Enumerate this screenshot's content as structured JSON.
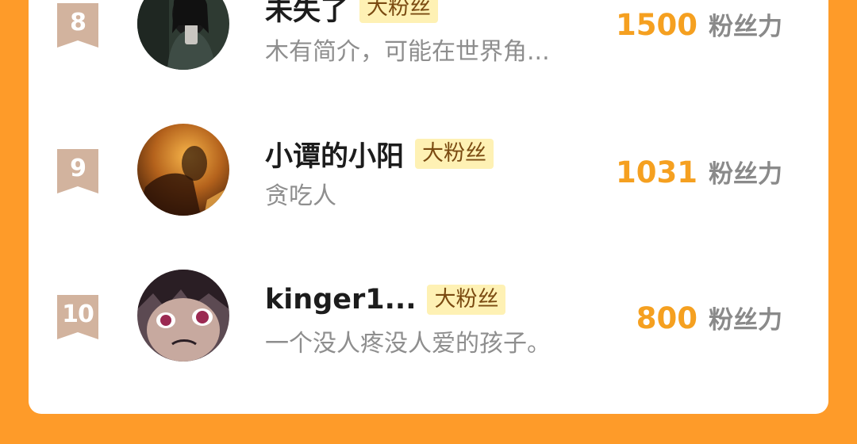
{
  "fans": [
    {
      "rank": "8",
      "name": "未失了",
      "tag": "大粉丝",
      "bio": "木有简介，可能在世界角...",
      "score": "1500",
      "score_unit": "粉丝力"
    },
    {
      "rank": "9",
      "name": "小谭的小阳",
      "tag": "大粉丝",
      "bio": "贪吃人",
      "score": "1031",
      "score_unit": "粉丝力"
    },
    {
      "rank": "10",
      "name": "kinger1...",
      "tag": "大粉丝",
      "bio": "一个没人疼没人爱的孩子。",
      "score": "800",
      "score_unit": "粉丝力"
    }
  ],
  "colors": {
    "background": "#FE9B29",
    "rank_badge": "#D2B39E",
    "tag_bg": "#FEF1B4",
    "score": "#F5A020"
  }
}
